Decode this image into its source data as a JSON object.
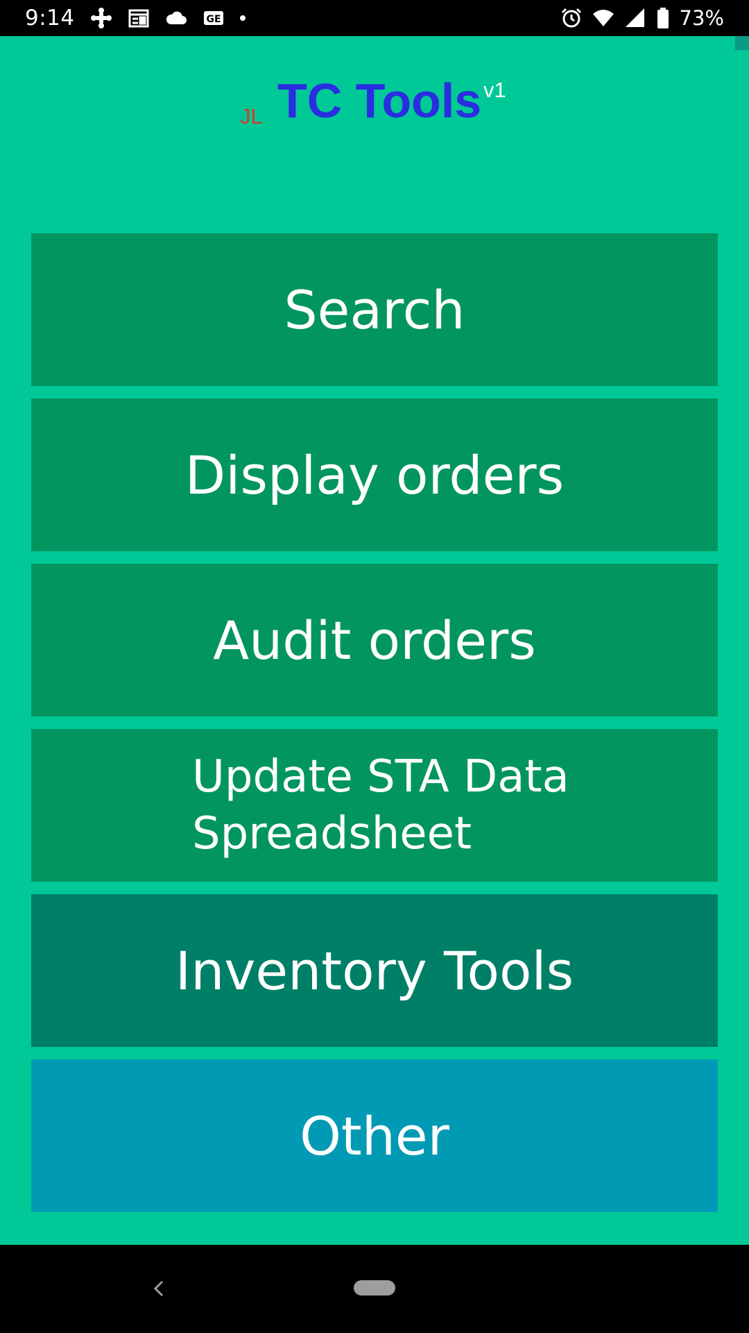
{
  "status_bar": {
    "time": "9:14",
    "battery": "73%",
    "left_icons": [
      "cbc-gem-icon",
      "calendar-news-icon",
      "cloud-icon",
      "ge-badge-icon",
      "notification-dot-icon"
    ],
    "right_icons": [
      "alarm-icon",
      "wifi-icon",
      "signal-icon",
      "battery-icon"
    ]
  },
  "header": {
    "initials": "JL",
    "title": "TC Tools",
    "version": "v1"
  },
  "menu": {
    "search": "Search",
    "display_orders": "Display orders",
    "audit_orders": "Audit orders",
    "update_sta": "Update STA Data\nSpreadsheet",
    "inventory_tools": "Inventory Tools",
    "other": "Other"
  },
  "colors": {
    "background": "#00c997",
    "button_green": "#03955f",
    "button_teal": "#007f67",
    "button_blue": "#009ab4",
    "title_blue": "#2b2de0",
    "initials_red": "#d33a2c"
  },
  "nav_bar": {
    "icons": [
      "back-icon",
      "home-pill-icon"
    ]
  }
}
